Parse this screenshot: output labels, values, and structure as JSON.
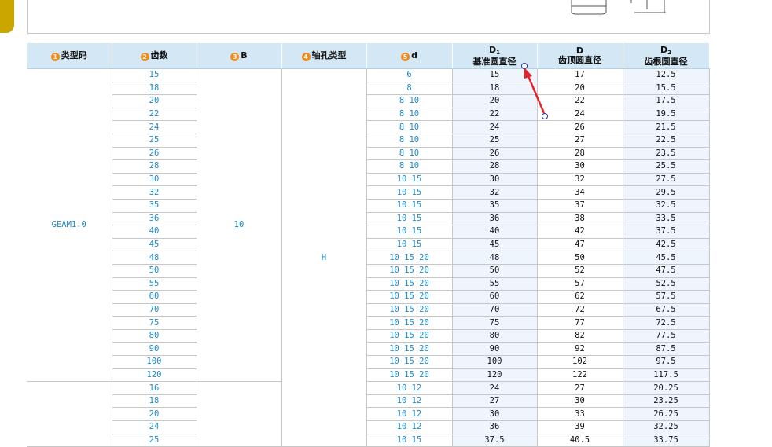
{
  "header": {
    "col1": {
      "num": "1",
      "label": "类型码"
    },
    "col2": {
      "num": "2",
      "label": "齿数"
    },
    "col3": {
      "num": "3",
      "label": "B"
    },
    "col4": {
      "num": "4",
      "label": "轴孔类型"
    },
    "col5": {
      "num": "5",
      "label": "d"
    },
    "col6": {
      "sym": "D",
      "sub": "1",
      "label": "基准圆直径"
    },
    "col7": {
      "sym": "D",
      "label": "齿顶圆直径"
    },
    "col8": {
      "sym": "D",
      "sub": "2",
      "label": "齿根圆直径"
    }
  },
  "groups": [
    {
      "type_code": "GEAM1.0",
      "B": "10"
    },
    {
      "type_code": "",
      "B": ""
    }
  ],
  "hole_type": "H",
  "rows": [
    {
      "teeth": "15",
      "d": "6",
      "D1": "15",
      "D": "17",
      "D2": "12.5"
    },
    {
      "teeth": "18",
      "d": "8",
      "D1": "18",
      "D": "20",
      "D2": "15.5"
    },
    {
      "teeth": "20",
      "d": "8  10",
      "D1": "20",
      "D": "22",
      "D2": "17.5"
    },
    {
      "teeth": "22",
      "d": "8  10",
      "D1": "22",
      "D": "24",
      "D2": "19.5"
    },
    {
      "teeth": "24",
      "d": "8  10",
      "D1": "24",
      "D": "26",
      "D2": "21.5"
    },
    {
      "teeth": "25",
      "d": "8  10",
      "D1": "25",
      "D": "27",
      "D2": "22.5"
    },
    {
      "teeth": "26",
      "d": "8  10",
      "D1": "26",
      "D": "28",
      "D2": "23.5"
    },
    {
      "teeth": "28",
      "d": "8  10",
      "D1": "28",
      "D": "30",
      "D2": "25.5"
    },
    {
      "teeth": "30",
      "d": "10  15",
      "D1": "30",
      "D": "32",
      "D2": "27.5"
    },
    {
      "teeth": "32",
      "d": "10  15",
      "D1": "32",
      "D": "34",
      "D2": "29.5"
    },
    {
      "teeth": "35",
      "d": "10  15",
      "D1": "35",
      "D": "37",
      "D2": "32.5"
    },
    {
      "teeth": "36",
      "d": "10  15",
      "D1": "36",
      "D": "38",
      "D2": "33.5"
    },
    {
      "teeth": "40",
      "d": "10  15",
      "D1": "40",
      "D": "42",
      "D2": "37.5"
    },
    {
      "teeth": "45",
      "d": "10  15",
      "D1": "45",
      "D": "47",
      "D2": "42.5"
    },
    {
      "teeth": "48",
      "d": "10  15  20",
      "D1": "48",
      "D": "50",
      "D2": "45.5"
    },
    {
      "teeth": "50",
      "d": "10  15  20",
      "D1": "50",
      "D": "52",
      "D2": "47.5"
    },
    {
      "teeth": "55",
      "d": "10  15  20",
      "D1": "55",
      "D": "57",
      "D2": "52.5"
    },
    {
      "teeth": "60",
      "d": "10  15  20",
      "D1": "60",
      "D": "62",
      "D2": "57.5"
    },
    {
      "teeth": "70",
      "d": "10  15  20",
      "D1": "70",
      "D": "72",
      "D2": "67.5"
    },
    {
      "teeth": "75",
      "d": "10  15  20",
      "D1": "75",
      "D": "77",
      "D2": "72.5"
    },
    {
      "teeth": "80",
      "d": "10  15  20",
      "D1": "80",
      "D": "82",
      "D2": "77.5"
    },
    {
      "teeth": "90",
      "d": "10  15  20",
      "D1": "90",
      "D": "92",
      "D2": "87.5"
    },
    {
      "teeth": "100",
      "d": "10  15  20",
      "D1": "100",
      "D": "102",
      "D2": "97.5"
    },
    {
      "teeth": "120",
      "d": "10  15  20",
      "D1": "120",
      "D": "122",
      "D2": "117.5"
    },
    {
      "teeth": "16",
      "d": "10  12",
      "D1": "24",
      "D": "27",
      "D2": "20.25"
    },
    {
      "teeth": "18",
      "d": "10  12",
      "D1": "27",
      "D": "30",
      "D2": "23.25"
    },
    {
      "teeth": "20",
      "d": "10  12",
      "D1": "30",
      "D": "33",
      "D2": "26.25"
    },
    {
      "teeth": "24",
      "d": "10  12",
      "D1": "36",
      "D": "39",
      "D2": "32.25"
    },
    {
      "teeth": "25",
      "d": "10  15",
      "D1": "37.5",
      "D": "40.5",
      "D2": "33.75"
    }
  ],
  "colors": {
    "header_bg": "#d4e7f5",
    "blue_text": "#1b8ac9",
    "badge": "#f08a1c",
    "arrow": "#e8202a"
  }
}
